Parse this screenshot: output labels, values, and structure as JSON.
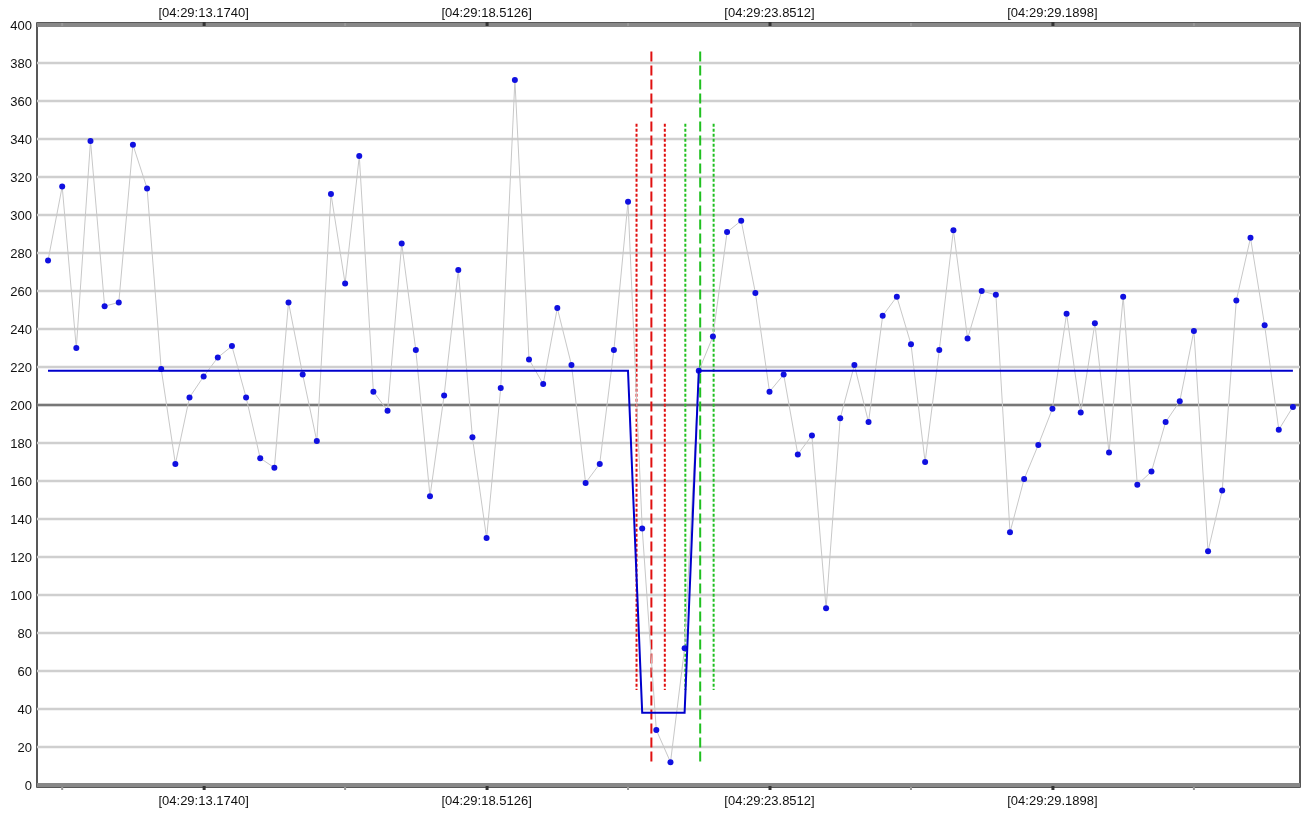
{
  "chart": {
    "top_labels": [
      "[04:29:13.1740]",
      "[04:29:18.5126]",
      "[04:29:23.8512]",
      "[04:29:29.1898]"
    ],
    "chart_data": {
      "type": "line",
      "ylim": [
        0,
        400
      ],
      "grid": true,
      "yticks": [
        0,
        20,
        40,
        60,
        80,
        100,
        120,
        140,
        160,
        180,
        200,
        220,
        240,
        260,
        280,
        300,
        320,
        340,
        360,
        380,
        400
      ],
      "categories": [
        null,
        null,
        null,
        null,
        null,
        null,
        null,
        null,
        null,
        null,
        null,
        "[04:29:13.1740]",
        null,
        null,
        null,
        null,
        null,
        null,
        null,
        null,
        null,
        null,
        null,
        null,
        null,
        null,
        null,
        null,
        null,
        null,
        null,
        "[04:29:18.5126]",
        null,
        null,
        null,
        null,
        null,
        null,
        null,
        null,
        null,
        null,
        null,
        null,
        null,
        null,
        null,
        null,
        null,
        null,
        null,
        "[04:29:23.8512]",
        null,
        null,
        null,
        null,
        null,
        null,
        null,
        null,
        null,
        null,
        null,
        null,
        null,
        null,
        null,
        null,
        null,
        null,
        null,
        "[04:29:29.1898]",
        null,
        null,
        null,
        null,
        null,
        null,
        null,
        null,
        null,
        null,
        null,
        null,
        null,
        null,
        null,
        null,
        null
      ],
      "series": [
        {
          "color": "#1010e0",
          "marker": "circle",
          "values": [
            276,
            315,
            230,
            339,
            252,
            254,
            337,
            314,
            219,
            169,
            204,
            215,
            225,
            231,
            204,
            172,
            167,
            254,
            216,
            181,
            311,
            264,
            331,
            207,
            197,
            285,
            229,
            152,
            205,
            271,
            183,
            130,
            209,
            371,
            224,
            211,
            251,
            221,
            159,
            169,
            229,
            307,
            135,
            29,
            12,
            72,
            218,
            236,
            291,
            297,
            259,
            207,
            216,
            174,
            184,
            93,
            193,
            221,
            191,
            247,
            257,
            232,
            170,
            229,
            292,
            235,
            260,
            258,
            133,
            161,
            179,
            198,
            248,
            196,
            243,
            175,
            257,
            158,
            165,
            191,
            202,
            239,
            123,
            155,
            255,
            288,
            242,
            187,
            199
          ]
        },
        {
          "color": "#0000cc",
          "values": [
            218,
            218,
            218,
            218,
            218,
            218,
            218,
            218,
            218,
            218,
            218,
            218,
            218,
            218,
            218,
            218,
            218,
            218,
            218,
            218,
            218,
            218,
            218,
            218,
            218,
            218,
            218,
            218,
            218,
            218,
            218,
            218,
            218,
            218,
            218,
            218,
            218,
            218,
            218,
            218,
            218,
            218,
            38,
            38,
            38,
            38,
            218,
            218,
            218,
            218,
            218,
            218,
            218,
            218,
            218,
            218,
            218,
            218,
            218,
            218,
            218,
            218,
            218,
            218,
            218,
            218,
            218,
            218,
            218,
            218,
            218,
            218,
            218,
            218,
            218,
            218,
            218,
            218,
            218,
            218,
            218,
            218,
            218,
            218,
            218,
            218,
            218,
            218,
            218
          ]
        }
      ],
      "ref_lines": [
        {
          "axis": "y",
          "value": 200,
          "color": "#777777"
        }
      ]
    }
  }
}
